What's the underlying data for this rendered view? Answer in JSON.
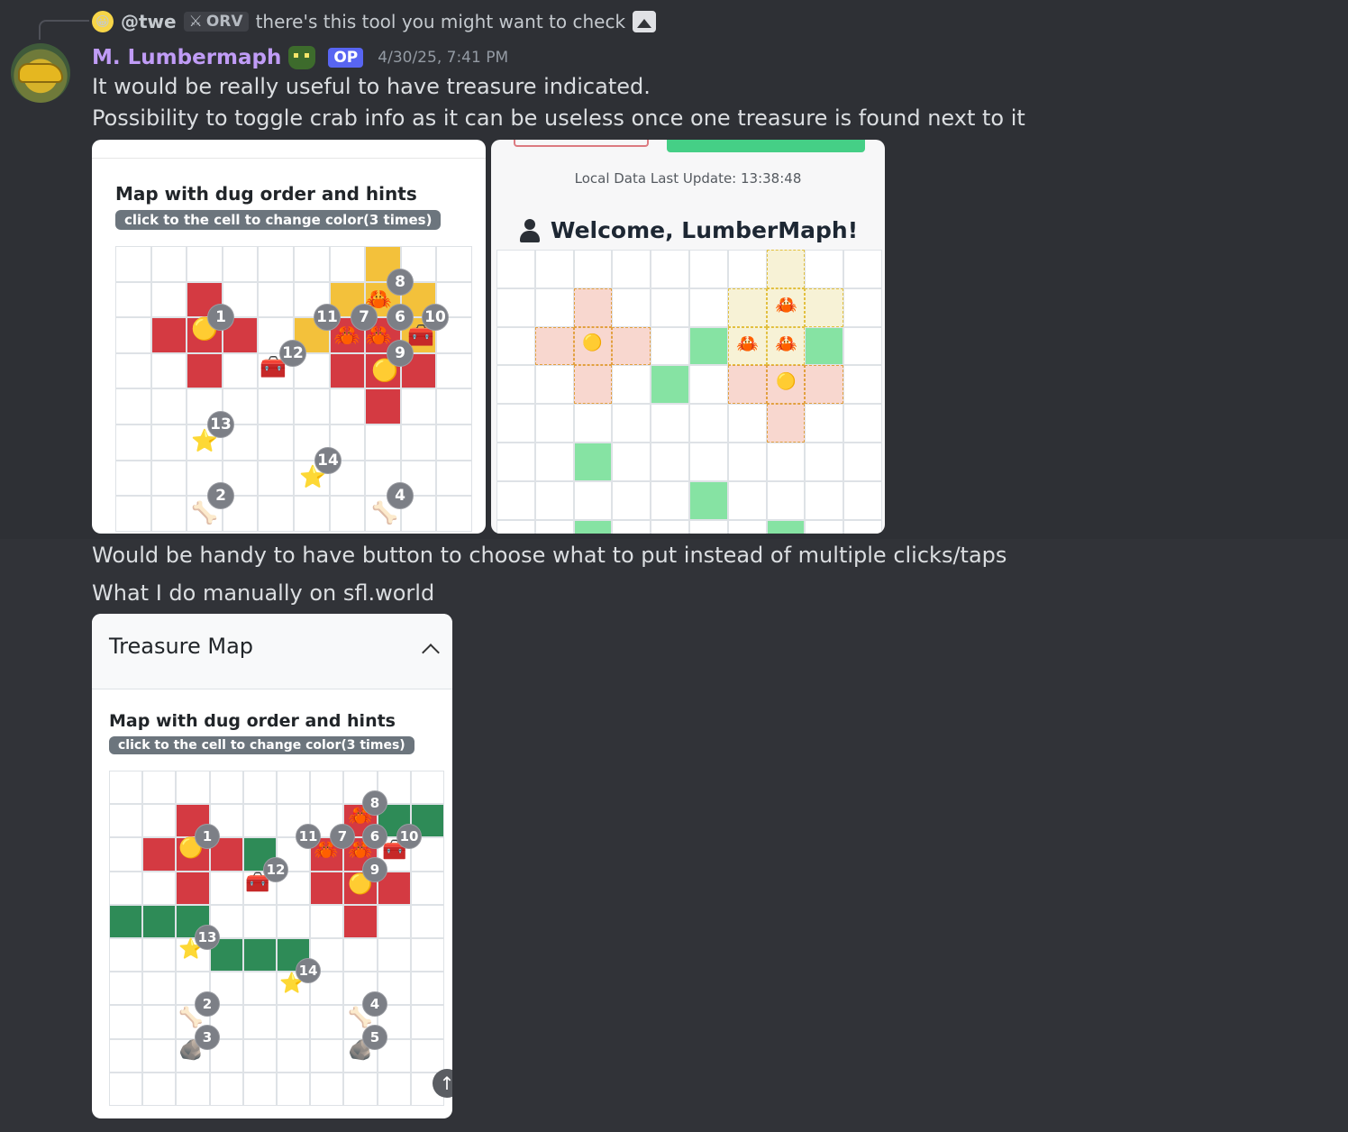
{
  "reply": {
    "username": "@twe",
    "tag": "ORV",
    "text": "there's this tool you might want to check"
  },
  "message": {
    "author": "M. Lumbermaph",
    "badge": "OP",
    "timestamp": "4/30/25, 7:41 PM",
    "lines": [
      "It would be really useful to have treasure indicated.",
      "Possibility to toggle crab info as it can be useless once one treasure is found next to it",
      "Would be handy to have button to choose what to put instead of multiple clicks/taps",
      "What I do manually on sfl.world"
    ]
  },
  "image1": {
    "title": "Map with dug order and hints",
    "hint": "click to the cell to change color(3 times)"
  },
  "image2": {
    "update": "Local Data Last Update: 13:38:48",
    "welcome": "Welcome, LumberMaph!"
  },
  "image3": {
    "header": "Treasure Map",
    "title": "Map with dug order and hints",
    "hint": "click to the cell to change color(3 times)"
  },
  "colors": {
    "author": "#c09cf6",
    "op_badge": "#5865f2",
    "background": "#313338",
    "red_cell": "#d43a42",
    "yellow_cell": "#f3c13b",
    "green_cell": "#2e8b57"
  }
}
